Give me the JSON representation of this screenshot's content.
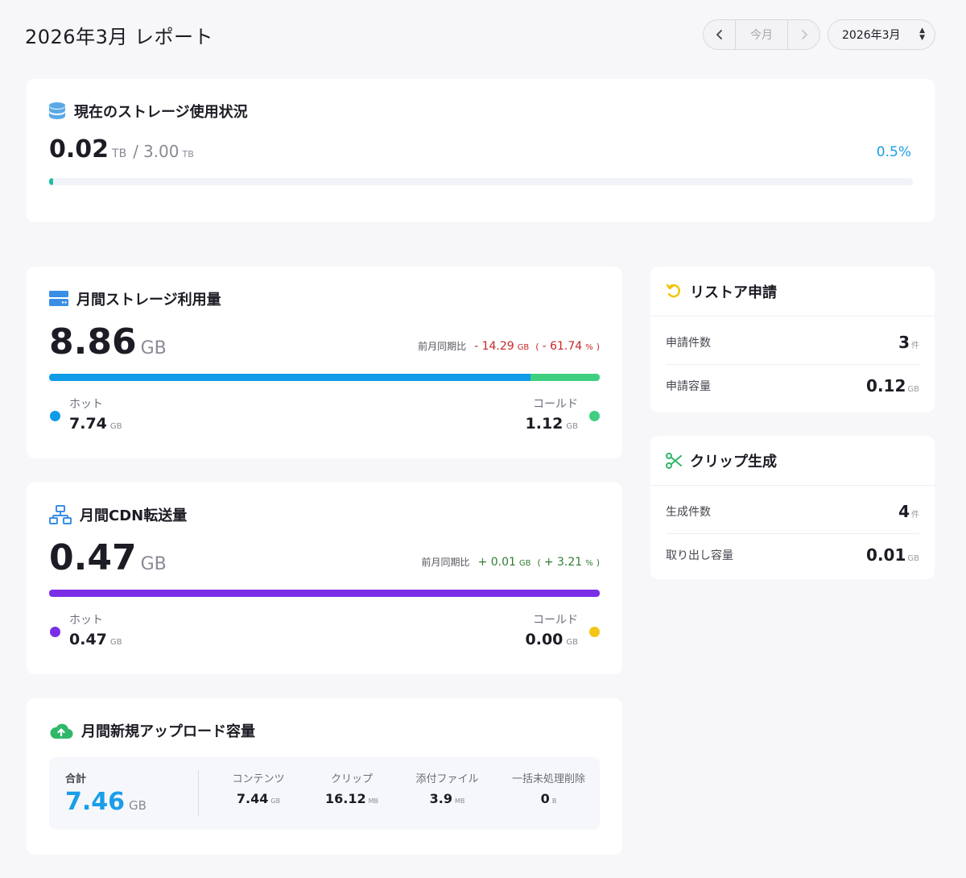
{
  "header": {
    "title": "2026年3月 レポート",
    "nav_prev": "‹",
    "nav_today": "今月",
    "nav_next": "›",
    "month_select": "2026年3月"
  },
  "storage": {
    "title": "現在のストレージ使用状況",
    "used": "0.02",
    "used_unit": "TB",
    "separator": "/",
    "total": "3.00",
    "total_unit": "TB",
    "percent": "0.5%",
    "fill_fraction": 0.005,
    "colors": {
      "fill": "#1bbfa6",
      "percent": "#1a9ee8"
    }
  },
  "monthly_storage": {
    "title": "月間ストレージ利用量",
    "value": "8.86",
    "unit": "GB",
    "compare_label": "前月同期比",
    "compare_value": "- 14.29",
    "compare_unit": "GB",
    "compare_pct_open": "(",
    "compare_pct": "- 61.74",
    "compare_pct_unit": "%",
    "compare_pct_close": ")",
    "compare_color": "#c62828",
    "hot_label": "ホット",
    "hot_value": "7.74",
    "hot_unit": "GB",
    "cold_label": "コールド",
    "cold_value": "1.12",
    "cold_unit": "GB",
    "hot_fraction": 0.874,
    "colors": {
      "hot": "#0f9be8",
      "cold": "#3fcf80"
    }
  },
  "monthly_cdn": {
    "title": "月間CDN転送量",
    "value": "0.47",
    "unit": "GB",
    "compare_label": "前月同期比",
    "compare_value": "+ 0.01",
    "compare_unit": "GB",
    "compare_pct_open": "(",
    "compare_pct": "+ 3.21",
    "compare_pct_unit": "%",
    "compare_pct_close": ")",
    "compare_color": "#2e7d32",
    "hot_label": "ホット",
    "hot_value": "0.47",
    "hot_unit": "GB",
    "cold_label": "コールド",
    "cold_value": "0.00",
    "cold_unit": "GB",
    "hot_fraction": 1.0,
    "colors": {
      "hot": "#7a2ee6",
      "cold": "#f5c518"
    }
  },
  "uploads": {
    "title": "月間新規アップロード容量",
    "total_label": "合計",
    "total_value": "7.46",
    "total_unit": "GB",
    "total_color": "#1a9ee8",
    "items": [
      {
        "label": "コンテンツ",
        "value": "7.44",
        "unit": "GB"
      },
      {
        "label": "クリップ",
        "value": "16.12",
        "unit": "MB"
      },
      {
        "label": "添付ファイル",
        "value": "3.9",
        "unit": "MB"
      },
      {
        "label": "一括未処理削除",
        "value": "0",
        "unit": "B"
      }
    ]
  },
  "restore": {
    "title": "リストア申請",
    "count_label": "申請件数",
    "count_value": "3",
    "count_unit": "件",
    "size_label": "申請容量",
    "size_value": "0.12",
    "size_unit": "GB"
  },
  "clip": {
    "title": "クリップ生成",
    "count_label": "生成件数",
    "count_value": "4",
    "count_unit": "件",
    "size_label": "取り出し容量",
    "size_value": "0.01",
    "size_unit": "GB"
  },
  "icons": {
    "storage": "database-icon",
    "monthly_storage": "server-icon",
    "cdn": "network-icon",
    "upload": "cloud-upload-icon",
    "restore": "undo-icon",
    "clip": "scissors-icon"
  }
}
